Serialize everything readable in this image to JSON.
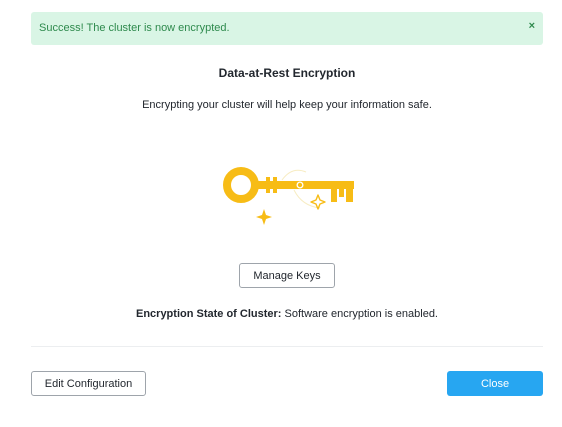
{
  "alert": {
    "message": "Success! The cluster is now encrypted.",
    "close_glyph": "×",
    "close_icon": "close-icon"
  },
  "dialog": {
    "title": "Data-at-Rest Encryption",
    "description": "Encrypting your cluster will help keep your information safe.",
    "illustration_icon": "key-icon",
    "manage_keys_label": "Manage Keys",
    "state_label": "Encryption State of Cluster:",
    "state_value": " Software encryption is enabled.",
    "edit_configuration_label": "Edit Configuration",
    "close_label": "Close"
  },
  "colors": {
    "success_bg": "#d9f5e5",
    "success_text": "#2e8a4d",
    "key": "#f7bc16",
    "primary": "#27a6f1"
  }
}
